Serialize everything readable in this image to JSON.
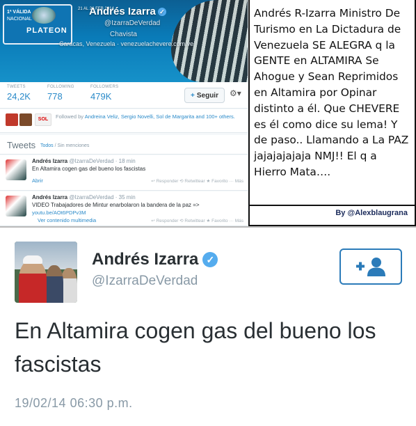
{
  "profile": {
    "badge": {
      "line1": "1ª VÁLIDA",
      "line2": "NACIONAL",
      "line3": "PLATEON"
    },
    "banner_date": "21 AL 26 FEB 2014",
    "name": "Andrés Izarra",
    "handle": "@IzarraDeVerdad",
    "bio": "Chavista",
    "location": "Caracas, Venezuela · venezuelachevere.com.ve",
    "stats": [
      {
        "label": "TWEETS",
        "value": "24,2K"
      },
      {
        "label": "FOLLOWING",
        "value": "778"
      },
      {
        "label": "FOLLOWERS",
        "value": "479K"
      }
    ],
    "follow_label": "Seguir",
    "followed_by": "Followed by",
    "followed_names": "Andreina Veliz, Sergio Novelli, Sol de Margarita",
    "followed_more": "and 100+ others.",
    "tweets_title": "Tweets",
    "tweets_filter_all": "Todos",
    "tweets_filter_sep": " / Sin menciones",
    "tweets": [
      {
        "name": "Andrés Izarra",
        "handle": "@IzarraDeVerdad",
        "time": "· 18 min",
        "text": "En Altamira cogen gas del bueno los fascistas",
        "link": "Abrir",
        "actions": "↩ Responder   ⟲ Retwittear   ★ Favorito   ··· Más"
      },
      {
        "name": "Andrés Izarra",
        "handle": "@IzarraDeVerdad",
        "time": "· 35 min",
        "text": "VIDEO Trabajadores de Mintur enarbolaron la bandera de la paz =>",
        "url": "youtu.be/AOt6PDPv3M",
        "link": "Ver contenido multimedia",
        "actions": "↩ Responder   ⟲ Retwittear   ★ Favorito   ··· Más"
      }
    ]
  },
  "caption": {
    "text": "Andrés R-Izarra Ministro De Turismo en La Dictadura de Venezuela SE ALEGRA q la GENTE en ALTAMIRA Se Ahogue y Sean Reprimidos en Altamira por Opinar distinto a él. Que CHEVERE es él como dice su lema! Y de paso.. Llamando a La PAZ jajajajajaja NMJ!! El q a Hierro Mata….",
    "credit": "By @Alexblaugrana"
  },
  "mobile_tweet": {
    "name": "Andrés Izarra",
    "verified_glyph": "✓",
    "handle": "@IzarraDeVerdad",
    "text": "En Altamira cogen gas del bueno los fascistas",
    "timestamp": "19/02/14 06:30 p.m."
  },
  "colors": {
    "twitter_blue": "#55acee",
    "link_blue": "#2a8ac9",
    "follow_border": "#2b7bb9",
    "muted_gray": "#8899a6",
    "text_dark": "#292f33"
  }
}
